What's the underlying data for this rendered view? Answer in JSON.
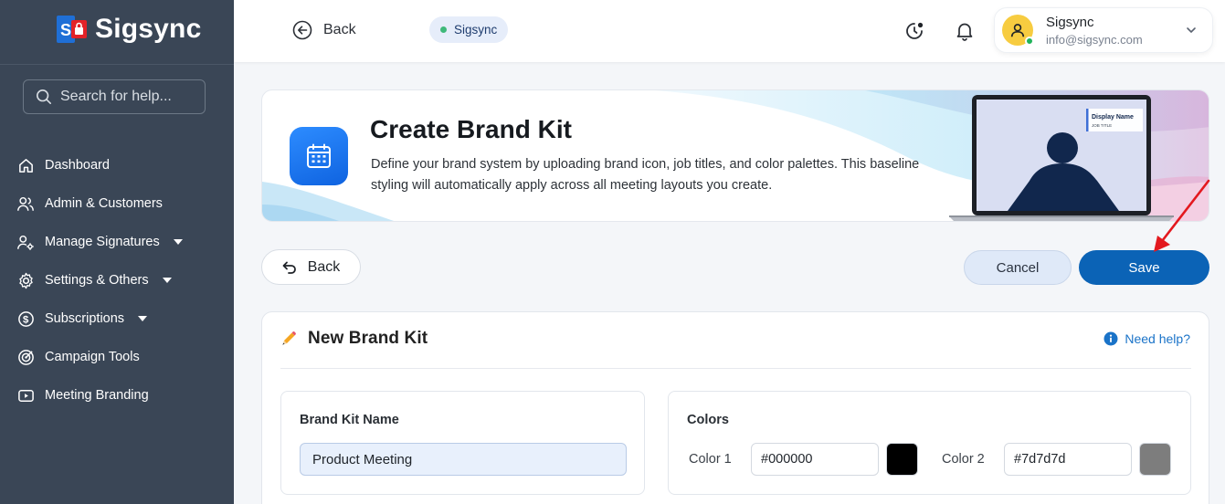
{
  "brand": {
    "name": "Sigsync"
  },
  "search": {
    "placeholder": "Search for help..."
  },
  "sidebar": {
    "items": [
      {
        "label": "Dashboard",
        "icon": "home-icon"
      },
      {
        "label": "Admin & Customers",
        "icon": "users-icon"
      },
      {
        "label": "Manage Signatures",
        "icon": "user-settings-icon",
        "has_caret": true
      },
      {
        "label": "Settings & Others",
        "icon": "gear-icon",
        "has_caret": true
      },
      {
        "label": "Subscriptions",
        "icon": "dollar-circle-icon",
        "has_caret": true
      },
      {
        "label": "Campaign Tools",
        "icon": "target-icon"
      },
      {
        "label": "Meeting Branding",
        "icon": "video-icon"
      }
    ]
  },
  "header": {
    "back_label": "Back",
    "org_pill": "Sigsync",
    "user": {
      "name": "Sigsync",
      "email": "info@sigsync.com"
    }
  },
  "banner": {
    "title": "Create Brand Kit",
    "description": "Define your brand system by uploading brand icon, job titles, and color palettes. This baseline styling will automatically apply across all meeting layouts you create.",
    "preview": {
      "display_name": "Display Name",
      "job_title": "JOB TITLE"
    }
  },
  "actions": {
    "back_label": "Back",
    "cancel_label": "Cancel",
    "save_label": "Save"
  },
  "form": {
    "title": "New Brand Kit",
    "help_label": "Need help?",
    "brand_kit_name": {
      "label": "Brand Kit Name",
      "value": "Product Meeting"
    },
    "colors": {
      "label": "Colors",
      "items": [
        {
          "label": "Color 1",
          "value": "#000000"
        },
        {
          "label": "Color 2",
          "value": "#7d7d7d"
        }
      ]
    }
  },
  "theme": {
    "sidebar_bg": "#3a4656",
    "primary": "#0b63b6",
    "accent_red": "#e32228"
  }
}
